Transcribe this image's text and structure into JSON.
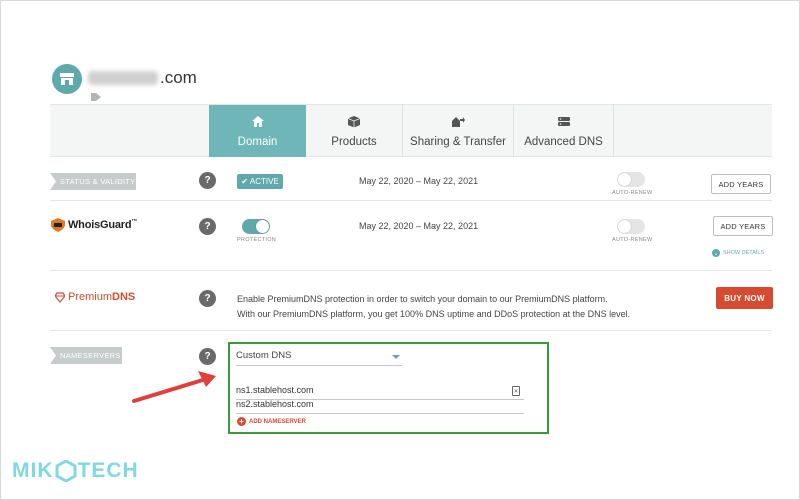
{
  "header": {
    "domain_suffix": ".com"
  },
  "tabs": [
    {
      "label": "Domain",
      "icon": "home-icon",
      "active": true
    },
    {
      "label": "Products",
      "icon": "box-icon",
      "active": false
    },
    {
      "label": "Sharing & Transfer",
      "icon": "share-icon",
      "active": false
    },
    {
      "label": "Advanced DNS",
      "icon": "dns-icon",
      "active": false
    }
  ],
  "status_row": {
    "label": "STATUS & VALIDITY",
    "help": "?",
    "badge": "ACTIVE",
    "dates": "May 22, 2020 – May 22, 2021",
    "toggle_caption": "AUTO-RENEW",
    "button": "ADD YEARS"
  },
  "whoisguard_row": {
    "brand": "WhoisGuard",
    "brand_tm": "™",
    "help": "?",
    "toggle_caption": "PROTECTION",
    "dates": "May 22, 2020 – May 22, 2021",
    "auto_renew_caption": "AUTO-RENEW",
    "button": "ADD YEARS",
    "show_details": "SHOW DETAILS"
  },
  "premiumdns_row": {
    "brand_prefix": "Premium",
    "brand_suffix": "DNS",
    "help": "?",
    "desc_line1": "Enable PremiumDNS protection in order to switch your domain to our PremiumDNS platform.",
    "desc_line2": "With our PremiumDNS platform, you get 100% DNS uptime and DDoS protection at the DNS level.",
    "button": "BUY NOW"
  },
  "nameservers": {
    "label": "NAMESERVERS",
    "help": "?",
    "selected": "Custom DNS",
    "ns1": "ns1.stablehost.com",
    "ns2": "ns2.stablehost.com",
    "add_label": "ADD NAMESERVER"
  },
  "watermark": {
    "left": "MIK",
    "right": "TECH"
  },
  "colors": {
    "teal": "#5fa9ad",
    "red": "#d64a30",
    "green_box": "#3a9a3a",
    "arrow": "#e0403a"
  }
}
